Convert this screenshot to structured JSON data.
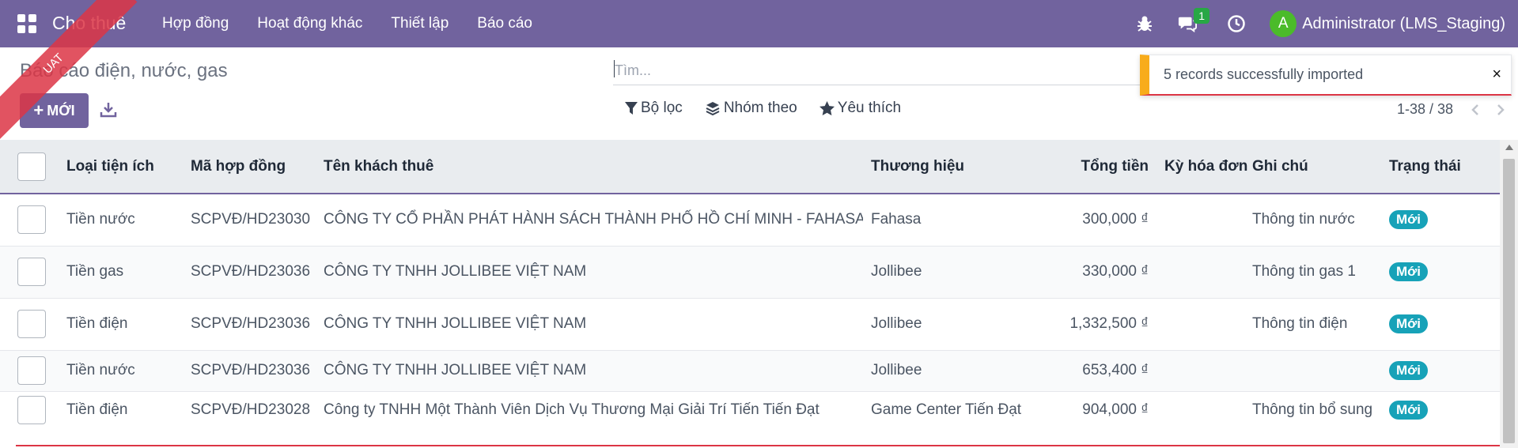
{
  "navbar": {
    "brand": "Cho thuê",
    "menu": [
      {
        "label": "Hợp đồng"
      },
      {
        "label": "Hoạt động khác"
      },
      {
        "label": "Thiết lập"
      },
      {
        "label": "Báo cáo"
      }
    ],
    "chat_count": "1",
    "user_initial": "A",
    "user_name": "Administrator (LMS_Staging)",
    "color": "#71639e"
  },
  "ribbon": {
    "label": "UAT"
  },
  "control_panel": {
    "title": "Báo cáo điện, nước, gas",
    "new_label": "MỚI",
    "search_placeholder": "Tìm...",
    "filters": {
      "filter": "Bộ lọc",
      "group_by": "Nhóm theo",
      "favorites": "Yêu thích"
    },
    "pager": "1-38 / 38"
  },
  "toast": {
    "message": "5 records successfully imported",
    "close": "×"
  },
  "table": {
    "columns": [
      "Loại tiện ích",
      "Mã hợp đồng",
      "Tên khách thuê",
      "Thương hiệu",
      "Tổng tiền",
      "Kỳ hóa đơn",
      "Ghi chú",
      "Trạng thái"
    ],
    "rows": [
      {
        "type": "Tiền nước",
        "contract": "SCPVĐ/HD23030",
        "tenant": "CÔNG TY CỔ PHẦN PHÁT HÀNH SÁCH THÀNH PHỐ HỒ CHÍ MINH - FAHASA",
        "brand": "Fahasa",
        "total": "300,000 ₫",
        "period": "",
        "note": "Thông tin nước",
        "status": "Mới"
      },
      {
        "type": "Tiền gas",
        "contract": "SCPVĐ/HD23036",
        "tenant": "CÔNG TY TNHH JOLLIBEE VIỆT NAM",
        "brand": "Jollibee",
        "total": "330,000 ₫",
        "period": "",
        "note": "Thông tin gas 1",
        "status": "Mới"
      },
      {
        "type": "Tiền điện",
        "contract": "SCPVĐ/HD23036",
        "tenant": "CÔNG TY TNHH JOLLIBEE VIỆT NAM",
        "brand": "Jollibee",
        "total": "1,332,500 ₫",
        "period": "",
        "note": "Thông tin điện",
        "status": "Mới"
      },
      {
        "type": "Tiền nước",
        "contract": "SCPVĐ/HD23036",
        "tenant": "CÔNG TY TNHH JOLLIBEE VIỆT NAM",
        "brand": "Jollibee",
        "total": "653,400 ₫",
        "period": "",
        "note": "",
        "status": "Mới"
      },
      {
        "type": "Tiền điện",
        "contract": "SCPVĐ/HD23028",
        "tenant": "Công ty TNHH Một Thành Viên Dịch Vụ Thương Mại Giải Trí Tiến Tiến Đạt",
        "brand": "Game Center Tiến Đạt",
        "total": "904,000 ₫",
        "period": "",
        "note": "Thông tin bổ sung",
        "status": "Mới"
      }
    ]
  }
}
